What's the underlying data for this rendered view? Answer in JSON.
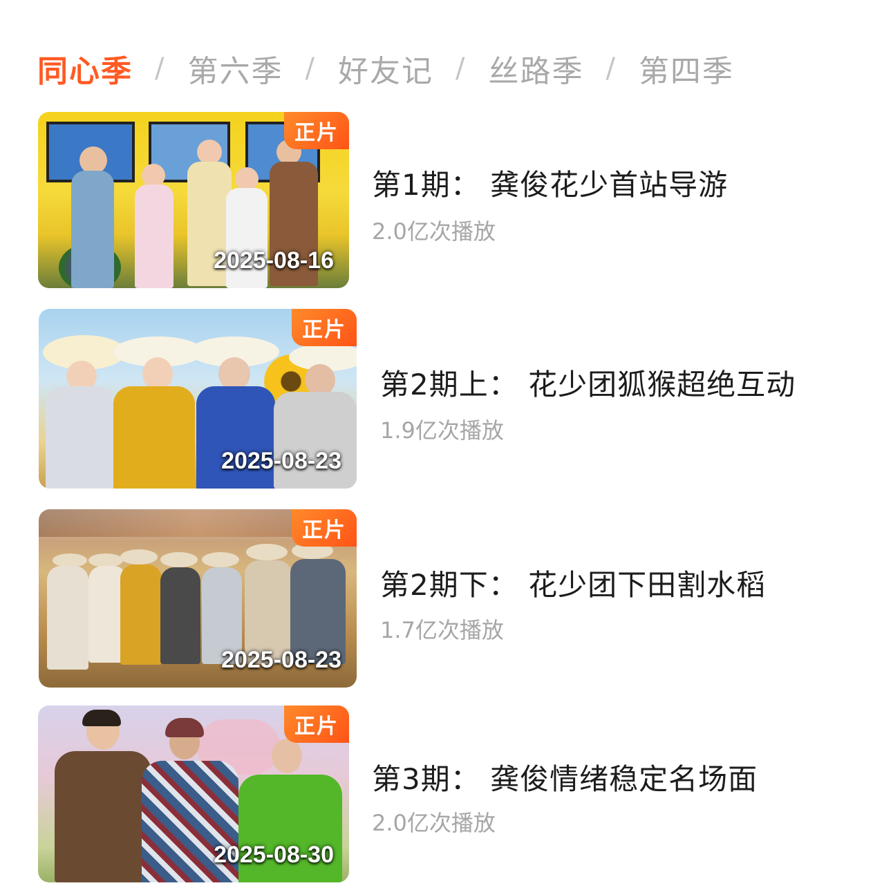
{
  "tabs": [
    {
      "label": "同心季",
      "active": true
    },
    {
      "label": "第六季",
      "active": false
    },
    {
      "label": "好友记",
      "active": false
    },
    {
      "label": "丝路季",
      "active": false
    },
    {
      "label": "第四季",
      "active": false
    }
  ],
  "separator": "/",
  "episodes": [
    {
      "badge": "正片",
      "date": "2025-08-16",
      "title": "第1期：  龚俊花少首站导游",
      "views": "2.0亿次播放"
    },
    {
      "badge": "正片",
      "date": "2025-08-23",
      "title": "第2期上：  花少团狐猴超绝互动",
      "views": "1.9亿次播放"
    },
    {
      "badge": "正片",
      "date": "2025-08-23",
      "title": "第2期下：  花少团下田割水稻",
      "views": "1.7亿次播放"
    },
    {
      "badge": "正片",
      "date": "2025-08-30",
      "title": "第3期：  龚俊情绪稳定名场面",
      "views": "2.0亿次播放"
    }
  ],
  "colors": {
    "accent": "#ff5a23",
    "badge": "#ff6a1f",
    "muted": "#a6a6a6"
  }
}
